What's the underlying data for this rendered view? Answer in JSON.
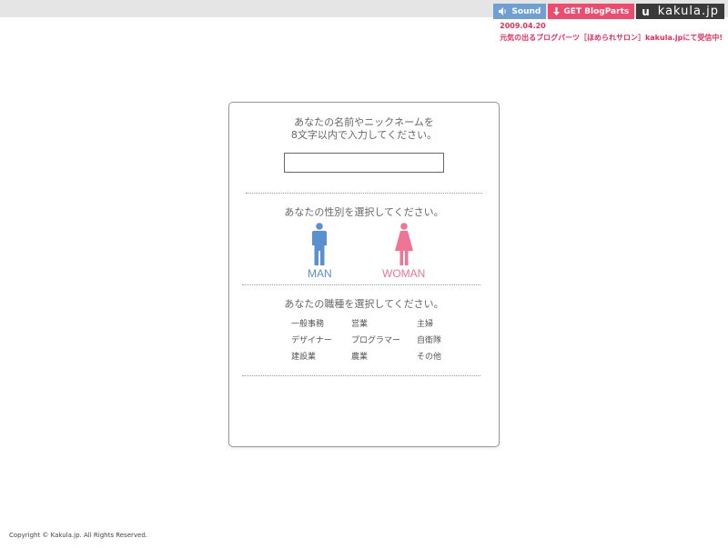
{
  "topbar": {
    "sound_label": "Sound",
    "blog_label": "GET BlogParts",
    "kakula_logo": "u",
    "kakula_label": "kakula.jp"
  },
  "news": {
    "date": "2009.04.20",
    "text": "元気の出るブログパーツ［ほめられサロン］kakula.jpにて受信中!"
  },
  "form": {
    "name_prompt_line1": "あなたの名前やニックネームを",
    "name_prompt_line2": "8文字以内で入力してください。",
    "name_value": "",
    "gender_prompt": "あなたの性別を選択してください。",
    "man_label": "MAN",
    "woman_label": "WOMAN",
    "job_prompt": "あなたの職種を選択してください。",
    "jobs": [
      "一般事務",
      "営業",
      "主婦",
      "デザイナー",
      "プログラマー",
      "自衛隊",
      "建設業",
      "農業",
      "その他"
    ]
  },
  "colors": {
    "man": "#5a8fd0",
    "woman": "#f07493",
    "accent_pink": "#ee4b6d",
    "sound_blue": "#6f9fd3"
  },
  "footer": {
    "copyright": "Copyright © Kakula.jp. All Rights Reserved."
  }
}
